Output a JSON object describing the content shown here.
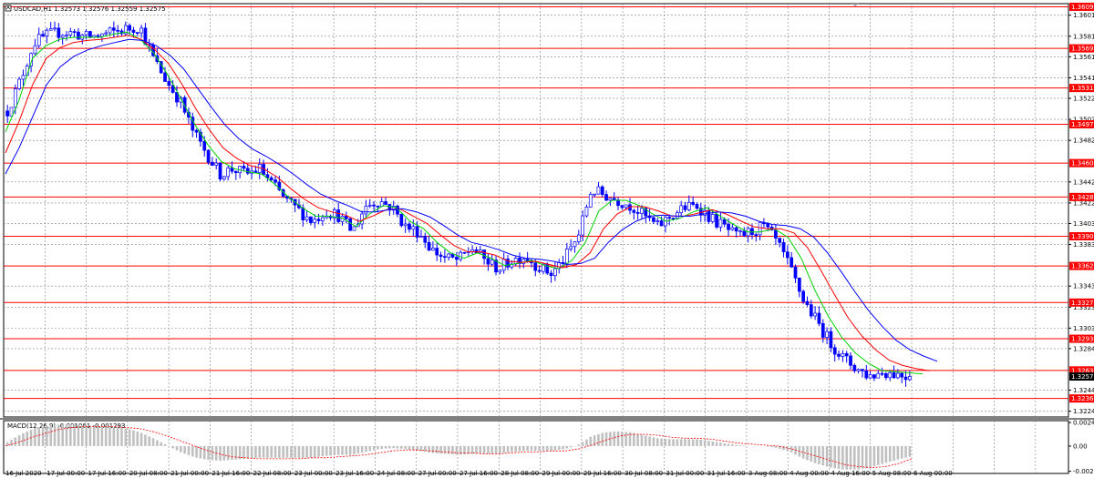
{
  "header": {
    "symbol_line": "USDCAD,H1  1.32573 1.32576 1.32559 1.32575"
  },
  "colors": {
    "candle": "#0000ff",
    "ma_fast": "#00d200",
    "ma_mid": "#ff0000",
    "ma_slow": "#0000ff",
    "level_line": "#ff0000",
    "price_badge": "#ff0000",
    "current_badge": "#000000",
    "macd_hist": "#c0c0c0",
    "macd_signal": "#ff0000",
    "grid": "#808080"
  },
  "chart_data": [
    {
      "type": "line",
      "title": "USDCAD,H1",
      "series_type": "ohlc-candles",
      "ohlc_last": {
        "open": 1.32573,
        "high": 1.32576,
        "low": 1.32559,
        "close": 1.32575
      },
      "x": [
        "16 Jul 2020",
        "17 Jul 00:00",
        "17 Jul 16:00",
        "20 Jul 08:00",
        "21 Jul 00:00",
        "21 Jul 16:00",
        "22 Jul 08:00",
        "23 Jul 00:00",
        "23 Jul 16:00",
        "24 Jul 08:00",
        "27 Jul 00:00",
        "27 Jul 16:00",
        "28 Jul 08:00",
        "29 Jul 00:00",
        "29 Jul 16:00",
        "30 Jul 08:00",
        "31 Jul 00:00",
        "31 Jul 16:00",
        "3 Aug 08:00",
        "4 Aug 00:00",
        "4 Aug 16:00",
        "5 Aug 08:00",
        "6 Aug 00:00"
      ],
      "y_ticks": [
        "1.36010",
        "1.35810",
        "1.35615",
        "1.35415",
        "1.35220",
        "1.35020",
        "1.34820",
        "1.34425",
        "1.34225",
        "1.34030",
        "1.33830",
        "1.33435",
        "1.33235",
        "1.33035",
        "1.32840",
        "1.32445",
        "1.32245"
      ],
      "close_path": [
        1.351,
        1.354,
        1.3575,
        1.3582,
        1.3585,
        1.3584,
        1.358,
        1.3582,
        1.3585,
        1.3588,
        1.359,
        1.356,
        1.3538,
        1.352,
        1.349,
        1.347,
        1.345,
        1.3455,
        1.345,
        1.3455,
        1.344,
        1.3425,
        1.3415,
        1.3405,
        1.3415,
        1.341,
        1.3395,
        1.342,
        1.3425,
        1.3418,
        1.34,
        1.3395,
        1.3378,
        1.337,
        1.3368,
        1.338,
        1.3368,
        1.336,
        1.3368,
        1.3372,
        1.3362,
        1.3355,
        1.337,
        1.339,
        1.3435,
        1.343,
        1.3425,
        1.342,
        1.341,
        1.34,
        1.341,
        1.3418,
        1.342,
        1.3408,
        1.34,
        1.339,
        1.3395,
        1.34,
        1.3385,
        1.336,
        1.333,
        1.331,
        1.329,
        1.3275,
        1.3265,
        1.3258,
        1.3262,
        1.326,
        1.32575
      ],
      "moving_averages": [
        {
          "color": "#00d200",
          "close_path": [
            1.349,
            1.352,
            1.356,
            1.3572,
            1.3578,
            1.358,
            1.358,
            1.358,
            1.3583,
            1.3585,
            1.3578,
            1.3565,
            1.3545,
            1.3522,
            1.3498,
            1.3478,
            1.3462,
            1.3455,
            1.3452,
            1.345,
            1.344,
            1.3428,
            1.3418,
            1.341,
            1.341,
            1.3408,
            1.34,
            1.3412,
            1.342,
            1.3418,
            1.3405,
            1.3398,
            1.3385,
            1.3375,
            1.337,
            1.3375,
            1.337,
            1.3363,
            1.3365,
            1.3368,
            1.3363,
            1.336,
            1.3368,
            1.3385,
            1.3415,
            1.3425,
            1.3425,
            1.342,
            1.3412,
            1.3405,
            1.3408,
            1.3414,
            1.3418,
            1.341,
            1.3402,
            1.3395,
            1.3395,
            1.3398,
            1.339,
            1.337,
            1.334,
            1.3315,
            1.3295,
            1.328,
            1.327,
            1.3263,
            1.3262,
            1.3261,
            1.326
          ]
        },
        {
          "color": "#ff0000",
          "close_path": [
            1.347,
            1.35,
            1.3535,
            1.356,
            1.357,
            1.3575,
            1.3577,
            1.3578,
            1.358,
            1.3582,
            1.3578,
            1.3568,
            1.3555,
            1.3535,
            1.3512,
            1.3492,
            1.3475,
            1.3465,
            1.3458,
            1.3455,
            1.3447,
            1.3436,
            1.3426,
            1.3418,
            1.3414,
            1.3411,
            1.3405,
            1.341,
            1.3416,
            1.3417,
            1.341,
            1.3403,
            1.3392,
            1.3382,
            1.3376,
            1.3376,
            1.3373,
            1.3367,
            1.3366,
            1.3367,
            1.3364,
            1.3361,
            1.3364,
            1.3375,
            1.3398,
            1.3412,
            1.3419,
            1.3419,
            1.3415,
            1.341,
            1.341,
            1.3413,
            1.3416,
            1.3412,
            1.3406,
            1.34,
            1.3398,
            1.3398,
            1.3394,
            1.338,
            1.3358,
            1.3335,
            1.3313,
            1.3296,
            1.3283,
            1.3273,
            1.3268,
            1.3265,
            1.3263
          ]
        },
        {
          "color": "#0000ff",
          "close_path": [
            1.345,
            1.3475,
            1.3505,
            1.3535,
            1.3552,
            1.3562,
            1.3568,
            1.3572,
            1.3575,
            1.3578,
            1.3577,
            1.3572,
            1.3563,
            1.355,
            1.3532,
            1.3514,
            1.3497,
            1.3484,
            1.3474,
            1.3467,
            1.3459,
            1.345,
            1.344,
            1.3431,
            1.3425,
            1.342,
            1.3414,
            1.3414,
            1.3416,
            1.3417,
            1.3414,
            1.3409,
            1.3401,
            1.3392,
            1.3385,
            1.3382,
            1.3378,
            1.3373,
            1.337,
            1.3369,
            1.3367,
            1.3364,
            1.3365,
            1.337,
            1.3385,
            1.3397,
            1.3405,
            1.341,
            1.3411,
            1.341,
            1.341,
            1.3412,
            1.3414,
            1.3413,
            1.341,
            1.3405,
            1.3402,
            1.3401,
            1.3398,
            1.339,
            1.3375,
            1.3357,
            1.3338,
            1.332,
            1.3305,
            1.3292,
            1.3283,
            1.3277,
            1.3272
          ]
        }
      ]
    },
    {
      "type": "line",
      "title": "MACD(12,26,9) -0.001061 -0.001293",
      "y_ticks": [
        "0.002408",
        "0.00",
        "-0.002578"
      ],
      "histogram": [
        0.0004,
        0.0012,
        0.0018,
        0.0021,
        0.0022,
        0.0022,
        0.0021,
        0.002,
        0.0019,
        0.0018,
        0.0014,
        0.0008,
        0.0001,
        -0.0006,
        -0.0011,
        -0.0014,
        -0.0015,
        -0.0014,
        -0.0013,
        -0.0012,
        -0.0012,
        -0.0012,
        -0.0012,
        -0.0012,
        -0.001,
        -0.0009,
        -0.0009,
        -0.0006,
        -0.0003,
        -0.0002,
        -0.0003,
        -0.0005,
        -0.0007,
        -0.0008,
        -0.0009,
        -0.0008,
        -0.0008,
        -0.0008,
        -0.0006,
        -0.0005,
        -0.0005,
        -0.0005,
        -0.0003,
        0.0001,
        0.001,
        0.0014,
        0.0015,
        0.0014,
        0.0011,
        0.0008,
        0.0007,
        0.0007,
        0.0007,
        0.0005,
        0.0003,
        0.0001,
        0.0,
        0.0,
        -0.0002,
        -0.0006,
        -0.0013,
        -0.0018,
        -0.0022,
        -0.0024,
        -0.0024,
        -0.0022,
        -0.0018,
        -0.0014,
        -0.0011
      ],
      "signal": [
        0.0,
        0.0004,
        0.0009,
        0.0013,
        0.0017,
        0.0019,
        0.002,
        0.002,
        0.002,
        0.0019,
        0.0018,
        0.0015,
        0.0011,
        0.0006,
        0.0001,
        -0.0004,
        -0.0008,
        -0.0011,
        -0.0012,
        -0.0013,
        -0.0013,
        -0.0013,
        -0.0013,
        -0.0012,
        -0.0012,
        -0.0011,
        -0.001,
        -0.0009,
        -0.0007,
        -0.0005,
        -0.0004,
        -0.0004,
        -0.0005,
        -0.0006,
        -0.0007,
        -0.0007,
        -0.0008,
        -0.0008,
        -0.0007,
        -0.0006,
        -0.0006,
        -0.0005,
        -0.0005,
        -0.0003,
        0.0001,
        0.0006,
        0.001,
        0.0012,
        0.0012,
        0.0011,
        0.0009,
        0.0008,
        0.0008,
        0.0007,
        0.0005,
        0.0003,
        0.0002,
        0.0001,
        0.0,
        -0.0003,
        -0.0007,
        -0.0011,
        -0.0015,
        -0.0019,
        -0.0021,
        -0.0022,
        -0.0021,
        -0.0018,
        -0.0013
      ]
    }
  ],
  "levels": [
    {
      "label": "1.36090",
      "price": 1.3609
    },
    {
      "label": "1.35695",
      "price": 1.35695
    },
    {
      "label": "1.35318",
      "price": 1.35318
    },
    {
      "label": "1.34973",
      "price": 1.34973
    },
    {
      "label": "1.34604",
      "price": 1.34604
    },
    {
      "label": "1.34282",
      "price": 1.34282
    },
    {
      "label": "1.33908",
      "price": 1.33908
    },
    {
      "label": "1.33626",
      "price": 1.33626
    },
    {
      "label": "1.33278",
      "price": 1.33278
    },
    {
      "label": "1.32934",
      "price": 1.32934
    },
    {
      "label": "1.32633",
      "price": 1.32633
    },
    {
      "label": "1.32366",
      "price": 1.32366
    }
  ],
  "current_price": {
    "label": "1.32575",
    "price": 1.32575
  }
}
